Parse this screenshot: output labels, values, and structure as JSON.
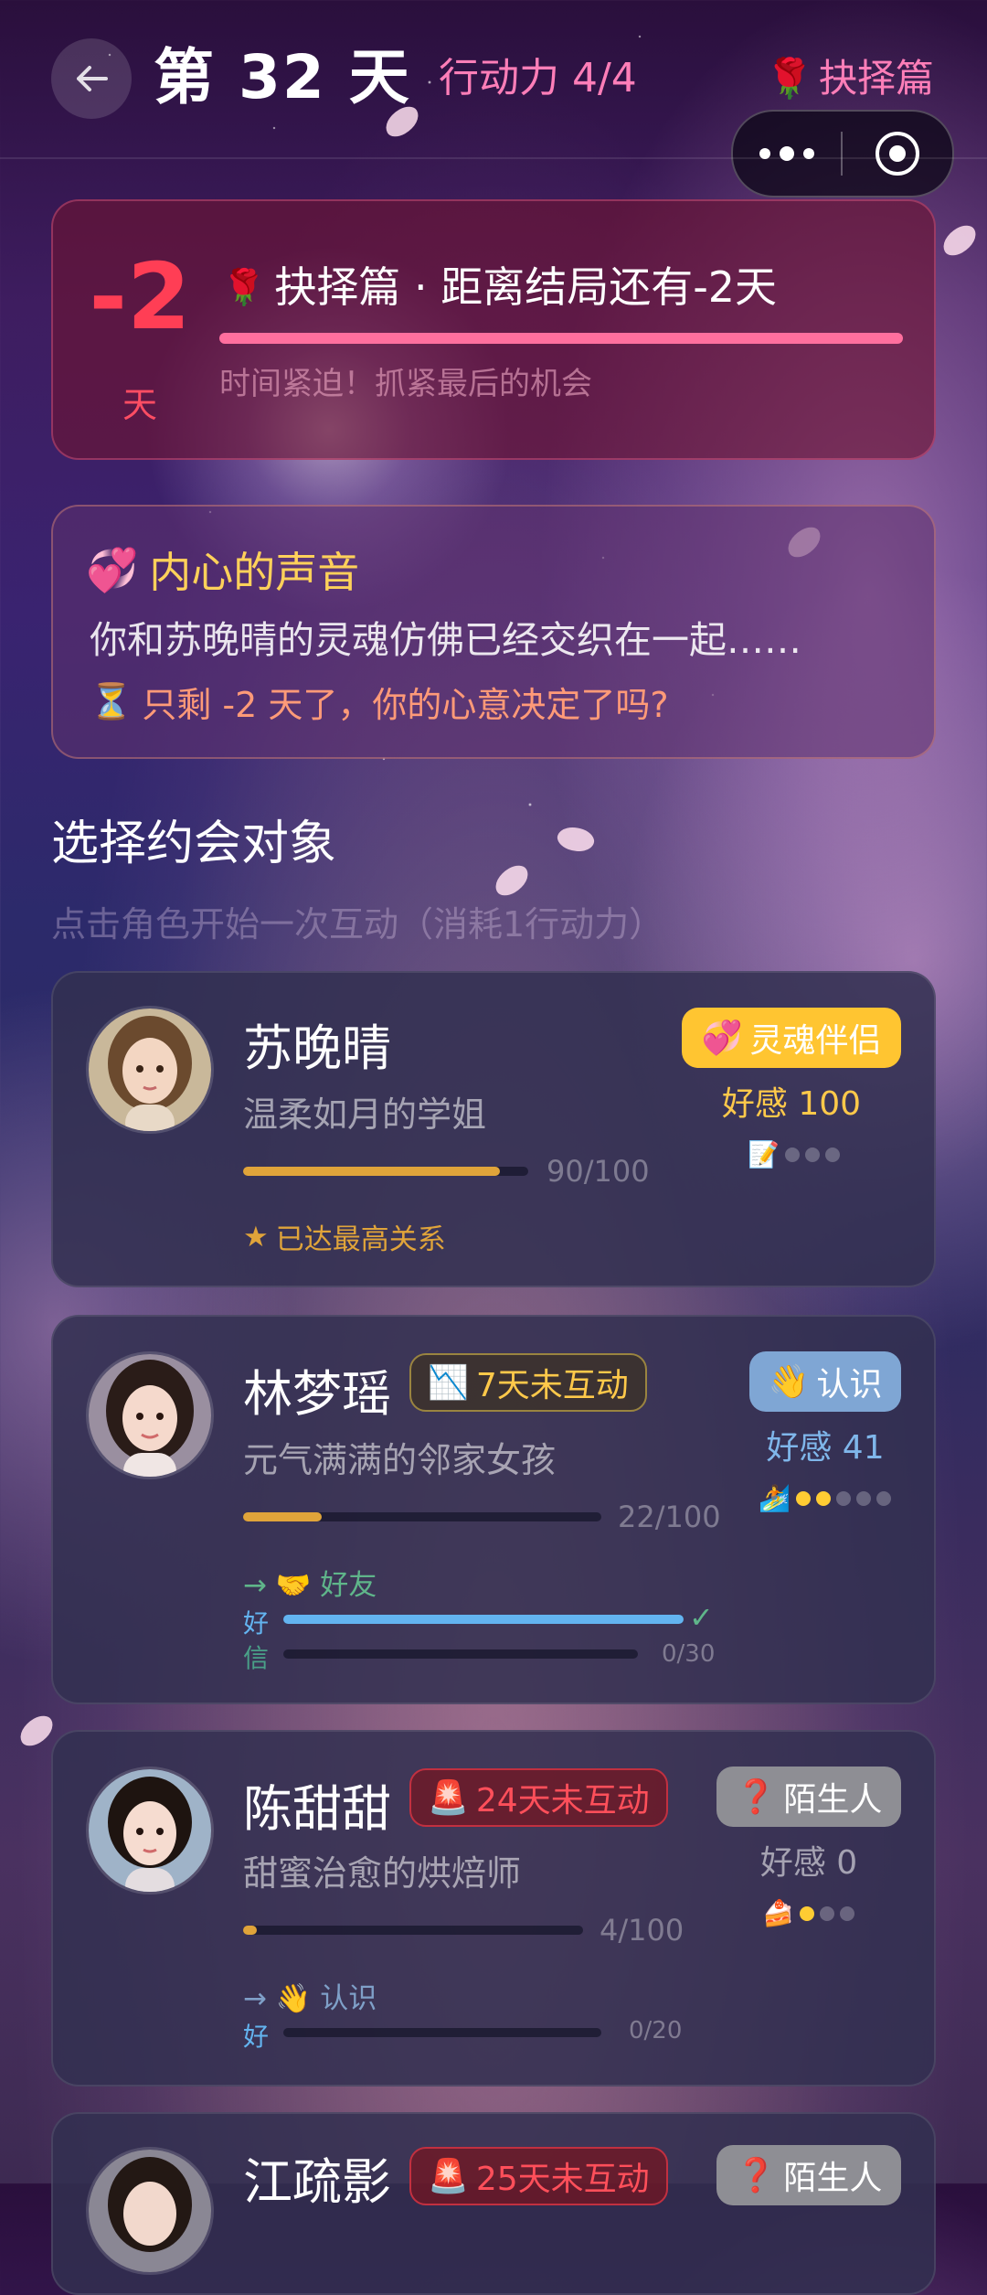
{
  "header": {
    "day_title": "第 32 天",
    "action_points": "行动力 4/4",
    "chapter": "抉择篇"
  },
  "countdown": {
    "days": "-2",
    "unit": "天",
    "title": "抉择篇 · 距离结局还有-2天",
    "hint": "时间紧迫！抓紧最后的机会"
  },
  "inner_voice": {
    "title": "内心的声音",
    "body": "你和苏晚晴的灵魂仿佛已经交织在一起……",
    "question": "只剩 -2 天了，你的心意决定了吗?"
  },
  "section": {
    "title": "选择约会对象",
    "subtitle": "点击角色开始一次互动（消耗1行动力）"
  },
  "characters": [
    {
      "name": "苏晚晴",
      "desc": "温柔如月的学姐",
      "progress_label": "90/100",
      "progress": 0.9,
      "note": "已达最高关系",
      "relation": "灵魂伴侣",
      "favor": "好感 100",
      "dots_on": 0,
      "dots_total": 3
    },
    {
      "name": "林梦瑶",
      "tag": "7天未互动",
      "desc": "元气满满的邻家女孩",
      "progress_label": "22/100",
      "progress": 0.22,
      "next_rel": "→ 🤝 好友",
      "hao": "好",
      "hao_progress": 1.0,
      "xin": "信",
      "xin_value": "0/30",
      "relation": "认识",
      "favor": "好感 41",
      "dots_on": 2,
      "dots_total": 5
    },
    {
      "name": "陈甜甜",
      "tag": "24天未互动",
      "desc": "甜蜜治愈的烘焙师",
      "progress_label": "4/100",
      "progress": 0.04,
      "next_rel": "→ 👋 认识",
      "hao": "好",
      "hao_value": "0/20",
      "relation": "陌生人",
      "favor": "好感 0",
      "dots_on": 1,
      "dots_total": 3
    },
    {
      "name": "江疏影",
      "tag": "25天未互动",
      "relation": "陌生人"
    }
  ],
  "colors": {
    "accent_pink": "#ff7eb8",
    "countdown_red": "#ff3e55",
    "gold": "#ffc94a",
    "blue": "#63b4f0"
  }
}
